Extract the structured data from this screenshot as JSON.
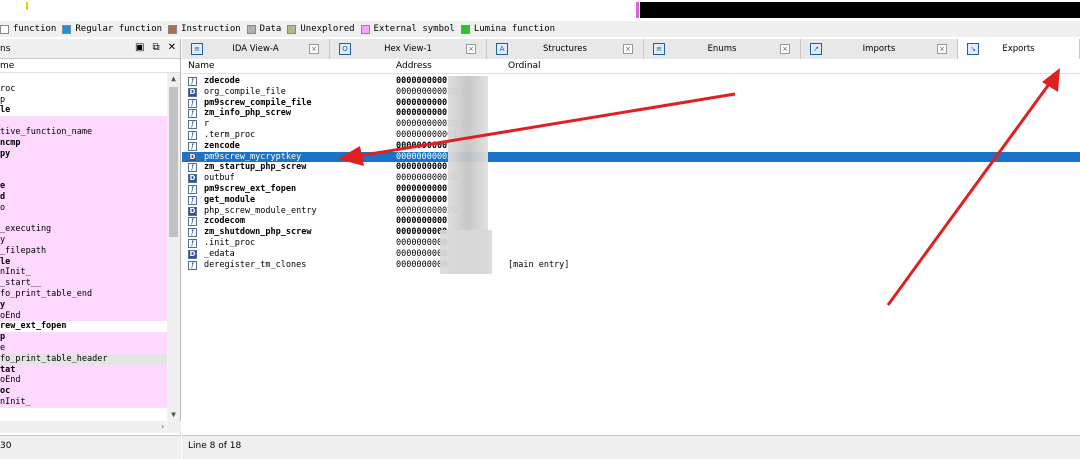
{
  "legend": [
    {
      "label": "function",
      "color": "#ffffff"
    },
    {
      "label": "Regular function",
      "color": "#2090e0"
    },
    {
      "label": "Instruction",
      "color": "#a87058"
    },
    {
      "label": "Data",
      "color": "#b0b0b0"
    },
    {
      "label": "Unexplored",
      "color": "#b8b890"
    },
    {
      "label": "External symbol",
      "color": "#ffa0ff"
    },
    {
      "label": "Lumina function",
      "color": "#30c030"
    }
  ],
  "left_panel": {
    "title": "ns",
    "column": "me",
    "status": "30",
    "rows": [
      {
        "text": "",
        "style": "white"
      },
      {
        "text": "roc",
        "style": "white"
      },
      {
        "text": "p",
        "style": "white"
      },
      {
        "text": "le",
        "style": "bold"
      },
      {
        "text": "",
        "style": "pink"
      },
      {
        "text": "tive_function_name",
        "style": "pink"
      },
      {
        "text": "ncmp",
        "style": "pink bold"
      },
      {
        "text": "py",
        "style": "pink bold"
      },
      {
        "text": "",
        "style": "pink"
      },
      {
        "text": "",
        "style": "pink"
      },
      {
        "text": "e",
        "style": "pink bold"
      },
      {
        "text": "d",
        "style": "pink bold"
      },
      {
        "text": "o",
        "style": "pink"
      },
      {
        "text": "",
        "style": "pink"
      },
      {
        "text": "_executing",
        "style": "pink"
      },
      {
        "text": "y",
        "style": "pink"
      },
      {
        "text": "_filepath",
        "style": "pink"
      },
      {
        "text": "le",
        "style": "pink bold"
      },
      {
        "text": "nInit_",
        "style": "pink"
      },
      {
        "text": "_start__",
        "style": "pink"
      },
      {
        "text": "fo_print_table_end",
        "style": "pink"
      },
      {
        "text": "y",
        "style": "pink bold"
      },
      {
        "text": "oEnd",
        "style": "pink"
      },
      {
        "text": "rew_ext_fopen",
        "style": "white bold"
      },
      {
        "text": "p",
        "style": "pink bold"
      },
      {
        "text": "e",
        "style": "pink"
      },
      {
        "text": "fo_print_table_header",
        "style": "grey"
      },
      {
        "text": "tat",
        "style": "pink bold"
      },
      {
        "text": "oEnd",
        "style": "pink"
      },
      {
        "text": "oc",
        "style": "pink bold"
      },
      {
        "text": "nInit_",
        "style": "pink"
      }
    ]
  },
  "tabs": [
    {
      "label": "IDA View-A",
      "icon": "ida-view-icon",
      "glyph": "≡",
      "active": false
    },
    {
      "label": "Hex View-1",
      "icon": "hex-view-icon",
      "glyph": "O",
      "active": false
    },
    {
      "label": "Structures",
      "icon": "structures-icon",
      "glyph": "A",
      "active": false
    },
    {
      "label": "Enums",
      "icon": "enums-icon",
      "glyph": "≡",
      "active": false
    },
    {
      "label": "Imports",
      "icon": "imports-icon",
      "glyph": "↗",
      "active": false
    },
    {
      "label": "Exports",
      "icon": "exports-icon",
      "glyph": "↘",
      "active": true
    }
  ],
  "exports_table": {
    "columns": {
      "name": "Name",
      "address": "Address",
      "ordinal": "Ordinal"
    },
    "rows": [
      {
        "icon": "f",
        "name": "zdecode",
        "address": "0000000000",
        "ordinal": "",
        "bold": true,
        "selected": false
      },
      {
        "icon": "D",
        "name": "org_compile_file",
        "address": "000000000020",
        "ordinal": "",
        "bold": false,
        "selected": false
      },
      {
        "icon": "f",
        "name": "pm9screw_compile_file",
        "address": "0000000000",
        "ordinal": "",
        "bold": true,
        "selected": false
      },
      {
        "icon": "f",
        "name": "zm_info_php_screw",
        "address": "0000000000",
        "ordinal": "",
        "bold": true,
        "selected": false
      },
      {
        "icon": "f",
        "name": "r",
        "address": "000000000020",
        "ordinal": "",
        "bold": false,
        "selected": false
      },
      {
        "icon": "f",
        "name": ".term_proc",
        "address": "000000000001",
        "ordinal": "",
        "bold": false,
        "selected": false
      },
      {
        "icon": "f",
        "name": "zencode",
        "address": "0000000000",
        "ordinal": "",
        "bold": true,
        "selected": false
      },
      {
        "icon": "D",
        "name": "pm9screw_mycryptkey",
        "address": "000000000020",
        "ordinal": "",
        "bold": false,
        "selected": true
      },
      {
        "icon": "f",
        "name": "zm_startup_php_screw",
        "address": "0000000000",
        "ordinal": "",
        "bold": true,
        "selected": false
      },
      {
        "icon": "D",
        "name": "outbuf",
        "address": "000000000020",
        "ordinal": "",
        "bold": false,
        "selected": false
      },
      {
        "icon": "f",
        "name": "pm9screw_ext_fopen",
        "address": "0000000000",
        "ordinal": "",
        "bold": true,
        "selected": false
      },
      {
        "icon": "f",
        "name": "get_module",
        "address": "0000000000",
        "ordinal": "",
        "bold": true,
        "selected": false
      },
      {
        "icon": "D",
        "name": "php_screw_module_entry",
        "address": "000000000020",
        "ordinal": "",
        "bold": false,
        "selected": false
      },
      {
        "icon": "f",
        "name": "zcodecom",
        "address": "0000000000",
        "ordinal": "",
        "bold": true,
        "selected": false
      },
      {
        "icon": "f",
        "name": "zm_shutdown_php_screw",
        "address": "0000000000",
        "ordinal": "",
        "bold": true,
        "selected": false
      },
      {
        "icon": "f",
        "name": ".init_proc",
        "address": "000000000001",
        "ordinal": "",
        "bold": false,
        "selected": false
      },
      {
        "icon": "D",
        "name": "_edata",
        "address": "000000000020",
        "ordinal": "",
        "bold": false,
        "selected": false
      },
      {
        "icon": "f",
        "name": "deregister_tm_clones",
        "address": "00000000000",
        "ordinal": "[main entry]",
        "bold": false,
        "selected": false
      }
    ]
  },
  "status": {
    "line_info": "Line 8 of 18"
  },
  "annotation_color": "#e02020"
}
